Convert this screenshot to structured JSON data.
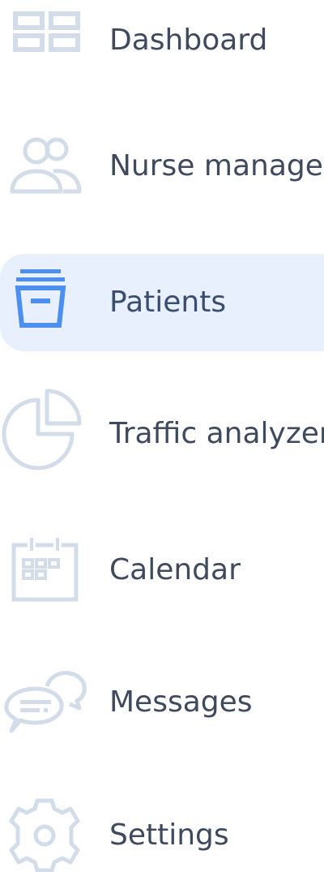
{
  "colors": {
    "icon_inactive": "#d3dce9",
    "icon_active": "#4c8ff1",
    "active_background": "#e9f0fd",
    "label_text": "#3f4a5e"
  },
  "sidebar": {
    "items": [
      {
        "label": "Dashboard",
        "icon": "dashboard-grid-icon",
        "active": false
      },
      {
        "label": "Nurse manager",
        "icon": "users-icon",
        "active": false
      },
      {
        "label": "Patients",
        "icon": "archive-box-icon",
        "active": true
      },
      {
        "label": "Traffic analyzer",
        "icon": "pie-chart-icon",
        "active": false
      },
      {
        "label": "Calendar",
        "icon": "calendar-icon",
        "active": false
      },
      {
        "label": "Messages",
        "icon": "chat-bubbles-icon",
        "active": false
      },
      {
        "label": "Settings",
        "icon": "gear-icon",
        "active": false
      }
    ]
  }
}
